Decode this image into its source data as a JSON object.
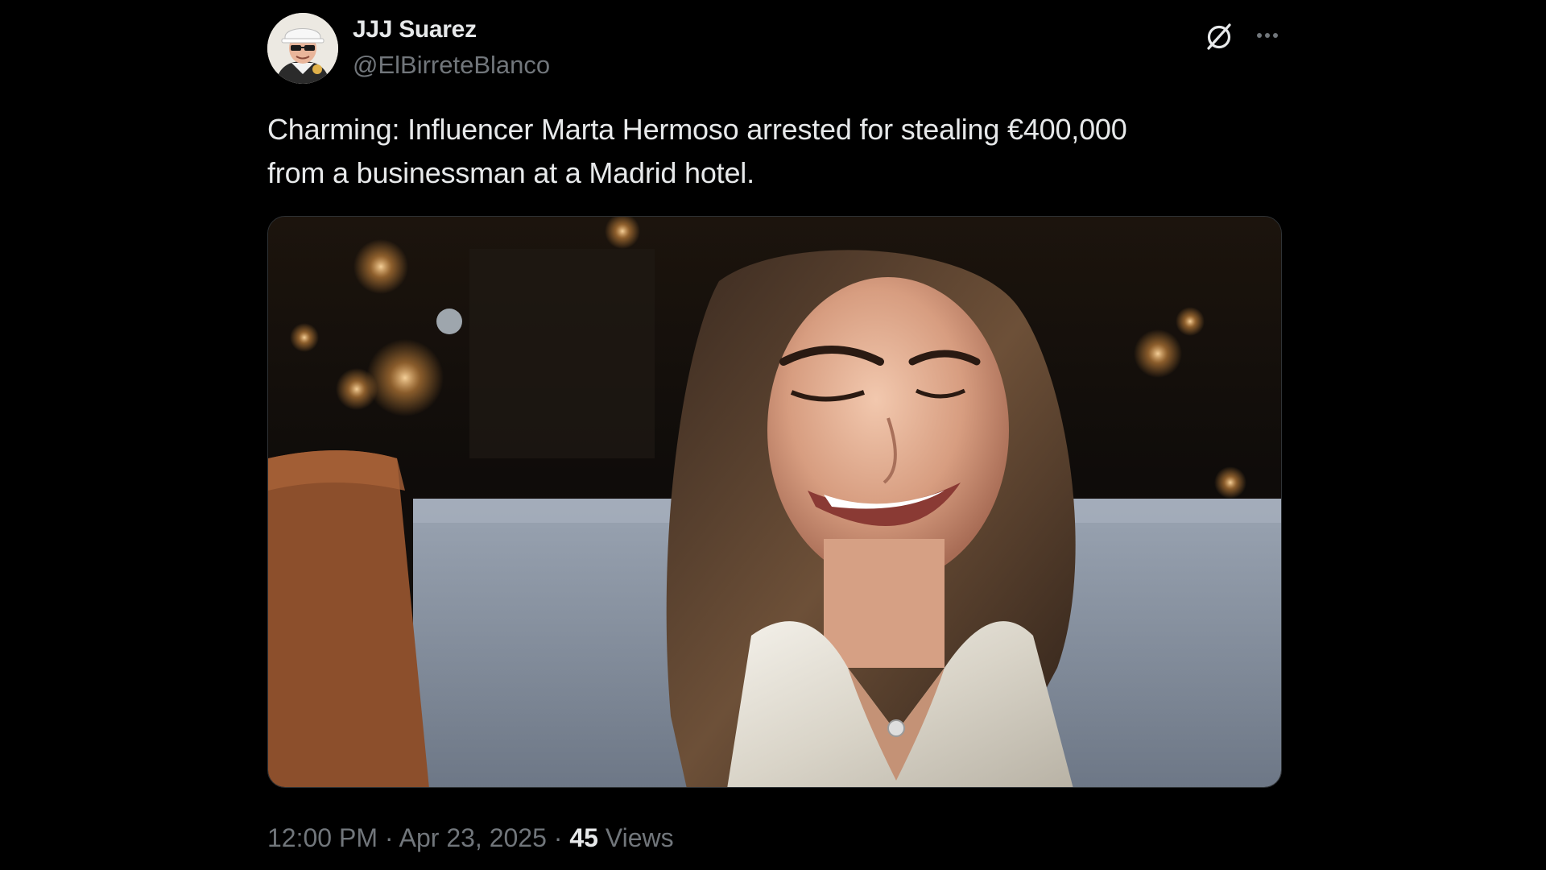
{
  "author": {
    "display_name": "JJJ Suarez",
    "handle": "@ElBirreteBlanco"
  },
  "actions": {
    "grok_icon": "grok-icon",
    "more_icon": "more-icon"
  },
  "post": {
    "text_line1": "Charming: Influencer Marta Hermoso arrested for stealing €400,000",
    "text_line2": "from a businessman at a Madrid hotel.",
    "media_alt": "Photo of a smiling woman with long brown hair in a white satin blouse seated in a dimly lit lounge"
  },
  "meta": {
    "time": "12:00 PM",
    "separator": " · ",
    "date": "Apr 23, 2025",
    "separator2": " · ",
    "views_count": "45",
    "views_label": " Views"
  },
  "colors": {
    "background": "#000000",
    "primary_text": "#e7e9ea",
    "secondary_text": "#71767b",
    "border": "#2f3336"
  }
}
